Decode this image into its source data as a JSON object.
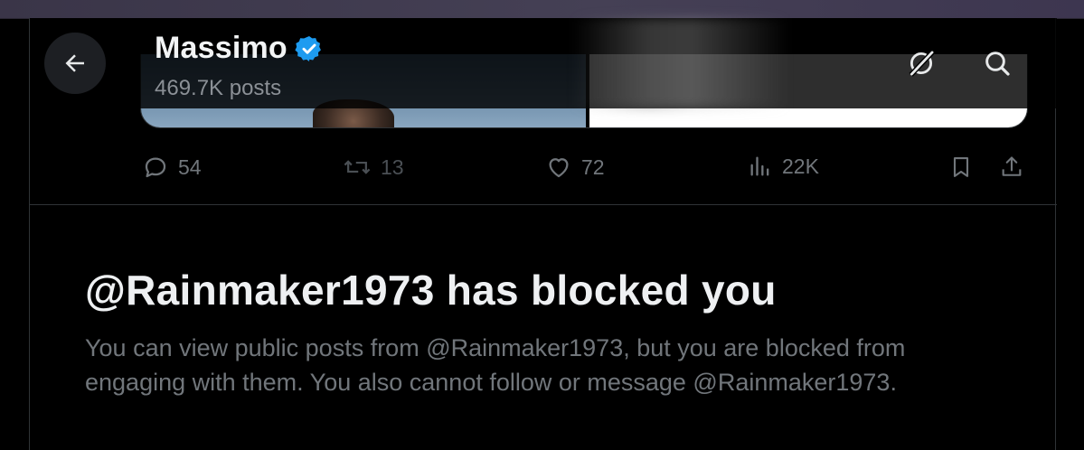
{
  "header": {
    "profile_name": "Massimo",
    "post_count": "469.7K posts",
    "verified_color": "#1d9bf0",
    "icons": [
      "back-arrow-icon",
      "grok-icon",
      "search-icon"
    ]
  },
  "post_actions": {
    "replies": "54",
    "reposts": "13",
    "likes": "72",
    "views": "22K"
  },
  "block_notice": {
    "title": "@Rainmaker1973 has blocked you",
    "description": "You can view public posts from @Rainmaker1973, but you are blocked from engaging with them. You also cannot follow or message @Rainmaker1973."
  }
}
